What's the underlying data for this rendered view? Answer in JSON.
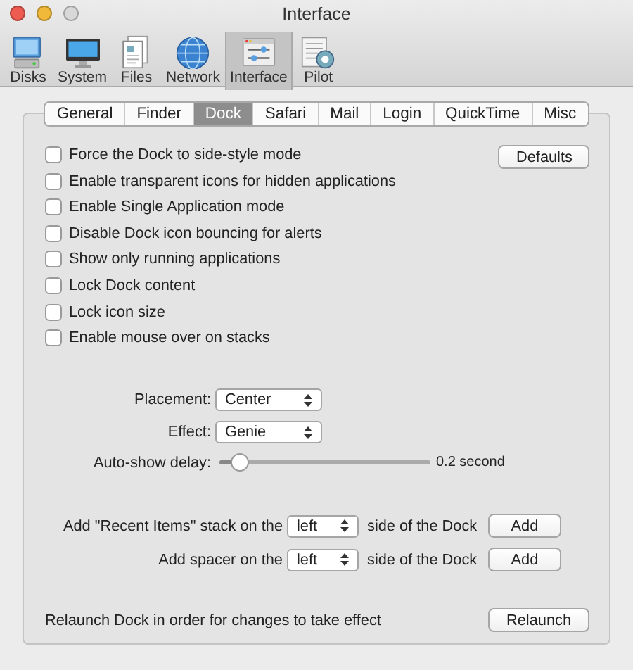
{
  "window": {
    "title": "Interface"
  },
  "toolbar": [
    {
      "label": "Disks",
      "selected": false
    },
    {
      "label": "System",
      "selected": false
    },
    {
      "label": "Files",
      "selected": false
    },
    {
      "label": "Network",
      "selected": false
    },
    {
      "label": "Interface",
      "selected": true
    },
    {
      "label": "Pilot",
      "selected": false
    }
  ],
  "tabs": [
    {
      "label": "General",
      "selected": false
    },
    {
      "label": "Finder",
      "selected": false
    },
    {
      "label": "Dock",
      "selected": true
    },
    {
      "label": "Safari",
      "selected": false
    },
    {
      "label": "Mail",
      "selected": false
    },
    {
      "label": "Login",
      "selected": false
    },
    {
      "label": "QuickTime",
      "selected": false
    },
    {
      "label": "Misc",
      "selected": false
    }
  ],
  "checkboxes": [
    {
      "label": "Force the Dock to side-style mode",
      "checked": false
    },
    {
      "label": "Enable transparent icons for hidden applications",
      "checked": false
    },
    {
      "label": "Enable Single Application mode",
      "checked": false
    },
    {
      "label": "Disable Dock icon bouncing for alerts",
      "checked": false
    },
    {
      "label": "Show only running applications",
      "checked": false
    },
    {
      "label": "Lock Dock content",
      "checked": false
    },
    {
      "label": "Lock icon size",
      "checked": false
    },
    {
      "label": "Enable mouse over on stacks",
      "checked": false
    }
  ],
  "defaults_button": "Defaults",
  "popups": [
    {
      "label": "Placement:",
      "value": "Center"
    },
    {
      "label": "Effect:",
      "value": "Genie"
    }
  ],
  "auto_show_delay": {
    "label": "Auto-show delay:",
    "level": 0.1,
    "reading": "0.2 second"
  },
  "stack_rows": [
    {
      "prefix": "Add \"Recent Items\" stack on the",
      "value": "left",
      "suffix": "side of the Dock",
      "button": "Add"
    },
    {
      "prefix": "Add spacer on the",
      "value": "left",
      "suffix": "side of the Dock",
      "button": "Add"
    }
  ],
  "relaunch": {
    "text": "Relaunch Dock in order for changes to take effect",
    "button": "Relaunch"
  }
}
